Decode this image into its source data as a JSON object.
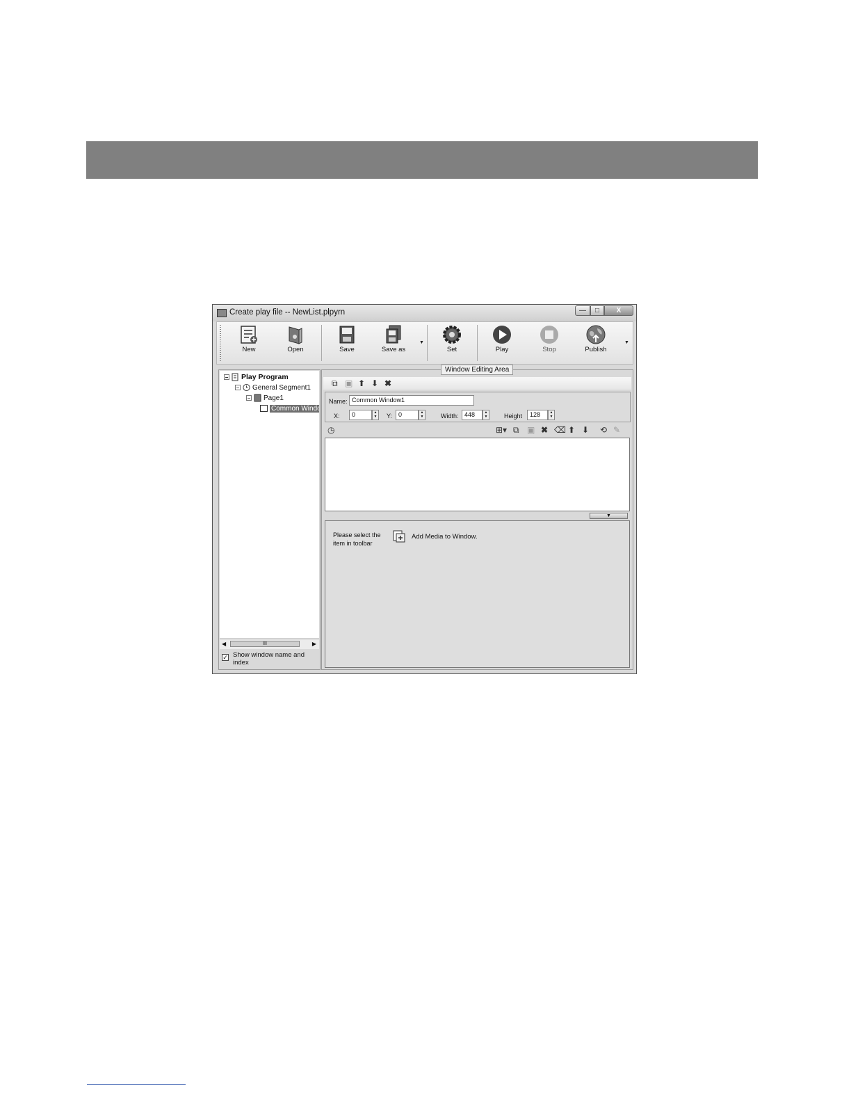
{
  "window": {
    "title": "Create play file  --  NewList.plpyrn",
    "controls": {
      "minimize": "—",
      "maximize": "□",
      "close": "X"
    }
  },
  "toolbar": {
    "new": "New",
    "open": "Open",
    "save": "Save",
    "save_as": "Save as",
    "set": "Set",
    "play": "Play",
    "stop": "Stop",
    "publish": "Publish",
    "dropdown_glyph": "▼"
  },
  "tree": {
    "root": "Play Program",
    "segment": "General Segment1",
    "page": "Page1",
    "window": "Common Windo",
    "scroll_thumb": "III",
    "show_names_checked": true,
    "show_names_label": "Show window name and index"
  },
  "editing_area": {
    "legend": "Window Editing Area",
    "name_label": "Name:",
    "name_value": "Common Window1",
    "x_label": "X:",
    "x_value": "0",
    "y_label": "Y:",
    "y_value": "0",
    "width_label": "Width:",
    "width_value": "448",
    "height_label": "Height",
    "height_value": "128",
    "hint": "Please select the item in toolbar",
    "add_media": "Add Media to Window."
  }
}
